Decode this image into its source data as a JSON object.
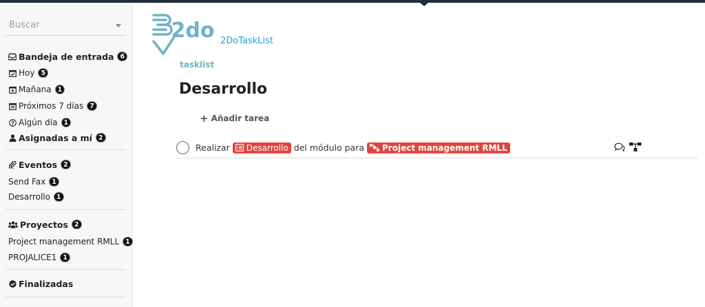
{
  "search": {
    "placeholder": "Buscar"
  },
  "sidebar": {
    "inbox": {
      "label": "Bandeja de entrada",
      "count": "6"
    },
    "today": {
      "label": "Hoy",
      "count": "5"
    },
    "tomorrow": {
      "label": "Mañana",
      "count": "1"
    },
    "next7": {
      "label": "Próximos 7 días",
      "count": "7"
    },
    "someday": {
      "label": "Algún día",
      "count": "1"
    },
    "assigned": {
      "label": "Asignadas a mí",
      "count": "2"
    },
    "events": {
      "label": "Eventos",
      "count": "2"
    },
    "event_items": [
      {
        "label": "Send Fax",
        "count": "1"
      },
      {
        "label": "Desarrollo",
        "count": "1"
      }
    ],
    "projects": {
      "label": "Proyectos",
      "count": "2"
    },
    "project_items": [
      {
        "label": "Project management RMLL",
        "count": "1"
      },
      {
        "label": "PROJALICE1",
        "count": "1"
      }
    ],
    "finished": {
      "label": "Finalizadas"
    }
  },
  "header": {
    "logo_text_main": "2do",
    "logo_text_sub": "tasklist",
    "app_name": "2DoTaskList"
  },
  "main": {
    "title": "Desarrollo",
    "add_task": "Añadir tarea",
    "task": {
      "prefix": "Realizar",
      "event_tag": "Desarrollo",
      "middle": "del módulo para",
      "project_tag": "Project management RMLL"
    }
  },
  "colors": {
    "accent": "#2a9fd6",
    "tag": "#e0463f",
    "logo": "#6fb3c7",
    "topbar": "#1f2d3d"
  },
  "icons": {
    "inbox": "inbox-icon",
    "today": "calendar-check-icon",
    "tomorrow": "calendar-plus-icon",
    "next7": "calendar-icon",
    "someday": "question-circle-icon",
    "assigned": "user-icon",
    "events": "paperclip-icon",
    "projects": "users-icon",
    "finished": "check-circle-icon",
    "add": "plus-icon",
    "comments": "comments-icon",
    "project": "sitemap-icon"
  }
}
